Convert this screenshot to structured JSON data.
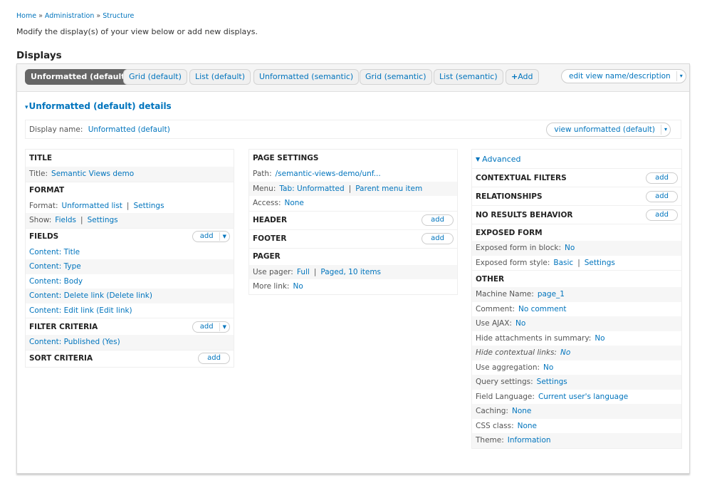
{
  "breadcrumb": {
    "items": [
      "Home",
      "Administration",
      "Structure"
    ],
    "separator": "»"
  },
  "intro": "Modify the display(s) of your view below or add new displays.",
  "displays_title": "Displays",
  "tabs": [
    {
      "label": "Unformatted (default)",
      "active": true
    },
    {
      "label": "Grid (default)",
      "active": false
    },
    {
      "label": "List (default)",
      "active": false
    },
    {
      "label": "Unformatted (semantic)",
      "active": false
    },
    {
      "label": "Grid (semantic)",
      "active": false
    },
    {
      "label": "List (semantic)",
      "active": false
    }
  ],
  "add_tab": {
    "icon": "+",
    "label": "Add"
  },
  "edit_view_dropdown": {
    "label": "edit view name/description",
    "caret": "▾"
  },
  "details": {
    "title": "Unformatted (default) details",
    "toggle_icon": "▾",
    "display_name_label": "Display name:",
    "display_name_value": "Unformatted (default)",
    "view_dropdown_label": "view unformatted (default)"
  },
  "left_column": {
    "title_section": {
      "heading": "TITLE",
      "label": "Title:",
      "value": "Semantic Views demo"
    },
    "format_section": {
      "heading": "FORMAT",
      "format_label": "Format:",
      "format_value": "Unformatted list",
      "format_settings": "Settings",
      "show_label": "Show:",
      "show_value": "Fields",
      "show_settings": "Settings"
    },
    "fields_section": {
      "heading": "FIELDS",
      "add_label": "add",
      "items": [
        "Content: Title",
        "Content: Type",
        "Content: Body",
        "Content: Delete link (Delete link)",
        "Content: Edit link (Edit link)"
      ]
    },
    "filter_section": {
      "heading": "FILTER CRITERIA",
      "add_label": "add",
      "items": [
        "Content: Published (Yes)"
      ]
    },
    "sort_section": {
      "heading": "SORT CRITERIA",
      "add_label": "add"
    }
  },
  "middle_column": {
    "page_settings": {
      "heading": "PAGE SETTINGS",
      "path_label": "Path:",
      "path_value": "/semantic-views-demo/unf...",
      "menu_label": "Menu:",
      "menu_value": "Tab: Unformatted",
      "menu_parent": "Parent menu item",
      "access_label": "Access:",
      "access_value": "None"
    },
    "header": {
      "heading": "HEADER",
      "add_label": "add"
    },
    "footer": {
      "heading": "FOOTER",
      "add_label": "add"
    },
    "pager": {
      "heading": "PAGER",
      "use_pager_label": "Use pager:",
      "use_pager_value": "Full",
      "use_pager_detail": "Paged, 10 items",
      "more_link_label": "More link:",
      "more_link_value": "No"
    }
  },
  "right_column": {
    "advanced_label": "Advanced",
    "contextual_filters": {
      "heading": "CONTEXTUAL FILTERS",
      "add_label": "add"
    },
    "relationships": {
      "heading": "RELATIONSHIPS",
      "add_label": "add"
    },
    "no_results": {
      "heading": "NO RESULTS BEHAVIOR",
      "add_label": "add"
    },
    "exposed_form": {
      "heading": "EXPOSED FORM",
      "in_block_label": "Exposed form in block:",
      "in_block_value": "No",
      "style_label": "Exposed form style:",
      "style_value": "Basic",
      "style_settings": "Settings"
    },
    "other": {
      "heading": "OTHER",
      "rows": [
        {
          "label": "Machine Name:",
          "value": "page_1"
        },
        {
          "label": "Comment:",
          "value": "No comment"
        },
        {
          "label": "Use AJAX:",
          "value": "No"
        },
        {
          "label": "Hide attachments in summary:",
          "value": "No"
        },
        {
          "label": "Hide contextual links:",
          "value": "No"
        },
        {
          "label": "Use aggregation:",
          "value": "No"
        },
        {
          "label": "Query settings:",
          "value": "Settings"
        },
        {
          "label": "Field Language:",
          "value": "Current user's language"
        },
        {
          "label": "Caching:",
          "value": "None"
        },
        {
          "label": "CSS class:",
          "value": "None"
        },
        {
          "label": "Theme:",
          "value": "Information"
        }
      ]
    }
  },
  "colors": {
    "link": "#0074bd",
    "active_tab_bg": "#666666",
    "text": "#333333"
  }
}
